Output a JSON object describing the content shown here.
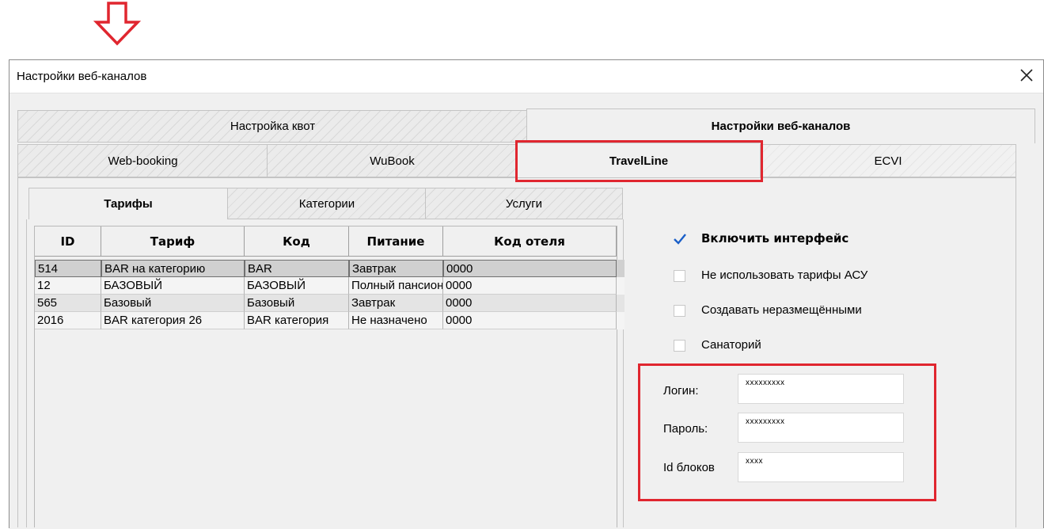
{
  "colors": {
    "annotation_red": "#e0262f",
    "checkmark_blue": "#1a5fc8"
  },
  "window": {
    "title": "Настройки веб-каналов",
    "close_glyph": "✕"
  },
  "top_tabs": [
    {
      "label": "Настройка квот",
      "active": false
    },
    {
      "label": "Настройки веб-каналов",
      "active": true
    }
  ],
  "channel_tabs": [
    {
      "label": "Web-booking",
      "active": false
    },
    {
      "label": "WuBook",
      "active": false
    },
    {
      "label": "TravelLine",
      "active": true
    },
    {
      "label": "ECVI",
      "active": false
    }
  ],
  "sub_tabs": [
    {
      "label": "Тарифы",
      "active": true
    },
    {
      "label": "Категории",
      "active": false
    },
    {
      "label": "Услуги",
      "active": false
    }
  ],
  "table": {
    "columns": [
      "ID",
      "Тариф",
      "Код",
      "Питание",
      "Код отеля"
    ],
    "rows": [
      [
        "514",
        "BAR на категорию",
        "BAR",
        "Завтрак",
        "0000"
      ],
      [
        "12",
        "БАЗОВЫЙ",
        "БАЗОВЫЙ",
        "Полный пансион",
        "0000"
      ],
      [
        "565",
        "Базовый",
        "Базовый",
        "Завтрак",
        "0000"
      ],
      [
        "2016",
        "BAR категория 26",
        "BAR категория",
        "Не назначено",
        "0000"
      ]
    ]
  },
  "options": [
    {
      "label": "Включить интерфейс",
      "checked": true
    },
    {
      "label": "Не использовать тарифы АСУ",
      "checked": false
    },
    {
      "label": "Создавать неразмещёнными",
      "checked": false
    },
    {
      "label": "Санаторий",
      "checked": false
    }
  ],
  "credentials": {
    "login_label": "Логин:",
    "login_value": "xxxxxxxxx",
    "password_label": "Пароль:",
    "password_value": "xxxxxxxxx",
    "blocks_label": "Id блоков",
    "blocks_value": "xxxx"
  }
}
